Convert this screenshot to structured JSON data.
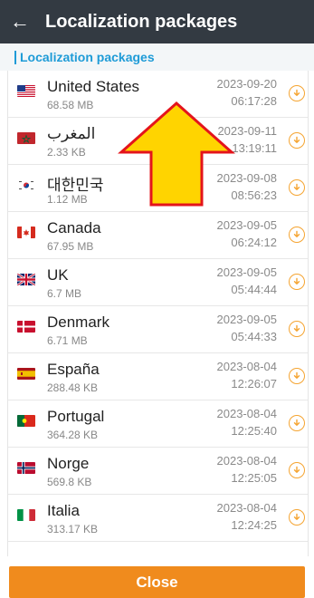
{
  "header": {
    "back_icon": "arrow-left-icon",
    "title": "Localization packages"
  },
  "section": {
    "label": "Localization packages"
  },
  "packages": [
    {
      "flag": "us",
      "name": "United States",
      "size": "68.58 MB",
      "date": "2023-09-20",
      "time": "06:17:28"
    },
    {
      "flag": "ma",
      "name": "المغرب",
      "size": "2.33 KB",
      "date": "2023-09-11",
      "time": "13:19:11"
    },
    {
      "flag": "kr",
      "name": "대한민국",
      "size": "1.12 MB",
      "date": "2023-09-08",
      "time": "08:56:23"
    },
    {
      "flag": "ca",
      "name": "Canada",
      "size": "67.95 MB",
      "date": "2023-09-05",
      "time": "06:24:12"
    },
    {
      "flag": "gb",
      "name": "UK",
      "size": "6.7 MB",
      "date": "2023-09-05",
      "time": "05:44:44"
    },
    {
      "flag": "dk",
      "name": "Denmark",
      "size": "6.71 MB",
      "date": "2023-09-05",
      "time": "05:44:33"
    },
    {
      "flag": "es",
      "name": "España",
      "size": "288.48 KB",
      "date": "2023-08-04",
      "time": "12:26:07"
    },
    {
      "flag": "pt",
      "name": "Portugal",
      "size": "364.28 KB",
      "date": "2023-08-04",
      "time": "12:25:40"
    },
    {
      "flag": "no",
      "name": "Norge",
      "size": "569.8 KB",
      "date": "2023-08-04",
      "time": "12:25:05"
    },
    {
      "flag": "it",
      "name": "Italia",
      "size": "313.17 KB",
      "date": "2023-08-04",
      "time": "12:24:25"
    }
  ],
  "row_action_icon": "download-icon",
  "footer": {
    "close_label": "Close"
  },
  "colors": {
    "header_bg": "#333a42",
    "accent": "#1e9bd7",
    "download": "#f5a431",
    "close_bg": "#f08b1d",
    "overlay_arrow_fill": "#ffd400",
    "overlay_arrow_stroke": "#e4141b"
  }
}
